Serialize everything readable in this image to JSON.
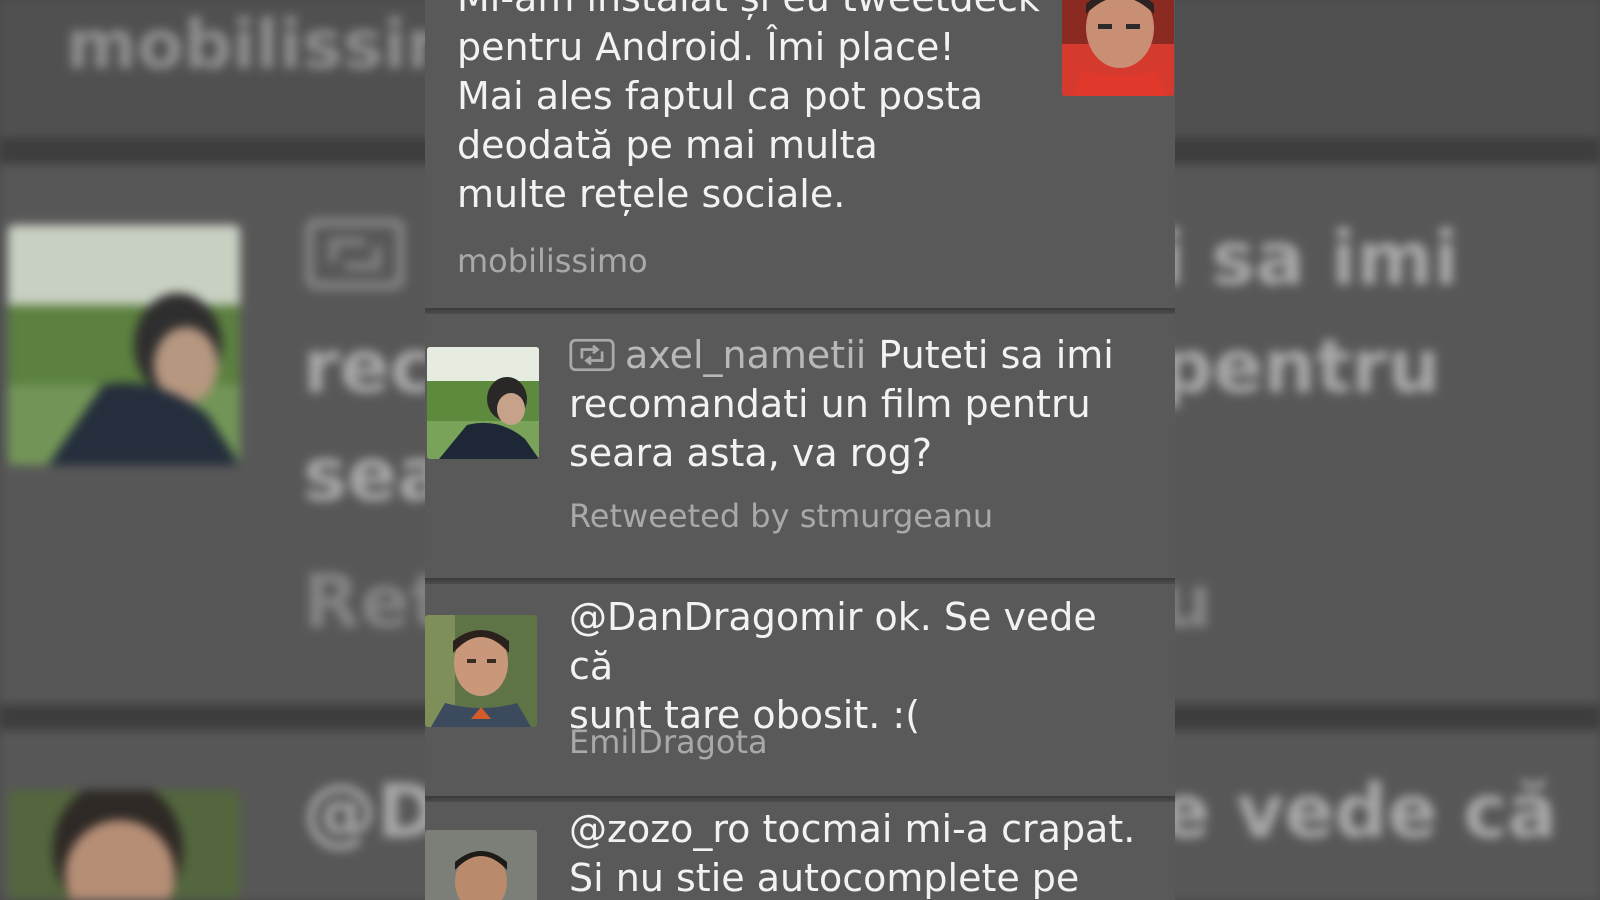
{
  "app": {
    "background_color": "#4a4a4a",
    "panel_color": "#595959",
    "text_color": "#f2f2f2",
    "meta_color": "#a9a9a9"
  },
  "tweets": [
    {
      "text_lines": [
        "Mi-am instalat și eu tweetdeck",
        "pentru Android. Îmi place!",
        "Mai ales faptul ca pot posta",
        "deodată pe mai multa",
        "multe rețele sociale."
      ],
      "author": "mobilissimo",
      "avatar_icon": "user-avatar-red-shirt"
    },
    {
      "retweet_icon": "retweet-icon",
      "handle": "axel_nametii",
      "text_first": "Puteti sa imi",
      "text_lines": [
        "recomandati un film pentru",
        "seara asta, va rog?"
      ],
      "meta": "Retweeted by stmurgeanu",
      "avatar_icon": "user-avatar-outdoor"
    },
    {
      "text_lines": [
        "@DanDragomir ok. Se vede că",
        "sunt tare obosit. :("
      ],
      "author": "EmilDragota",
      "avatar_icon": "user-avatar-young-man"
    },
    {
      "text_lines": [
        "@zozo_ro tocmai mi-a crapat.",
        "Si nu stie autocomplete pe"
      ],
      "avatar_icon": "user-avatar-man"
    }
  ],
  "background_echo": {
    "word_top": "mobilissim",
    "left_fragments": [
      "rec",
      "sea",
      "Ret",
      "@D"
    ],
    "right_fragments": [
      "i sa imi",
      "pentru",
      "u",
      "e vede că"
    ]
  }
}
